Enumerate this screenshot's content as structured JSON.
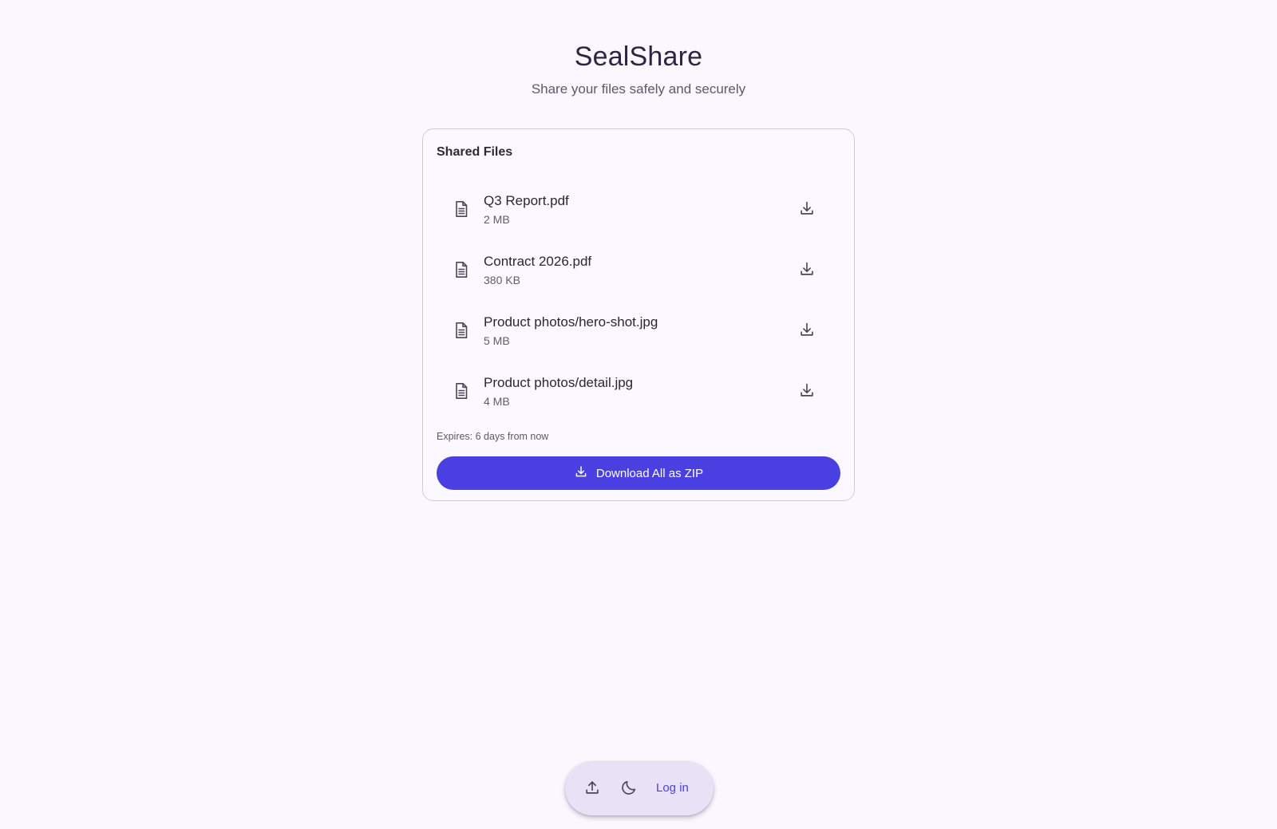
{
  "app": {
    "title": "SealShare",
    "subtitle": "Share your files safely and securely"
  },
  "card": {
    "title": "Shared Files",
    "files": [
      {
        "name": "Q3 Report.pdf",
        "size": "2 MB",
        "icon": "file-document-icon"
      },
      {
        "name": "Contract 2026.pdf",
        "size": "380 KB",
        "icon": "file-document-icon"
      },
      {
        "name": "Product photos/hero-shot.jpg",
        "size": "5 MB",
        "icon": "file-document-icon"
      },
      {
        "name": "Product photos/detail.jpg",
        "size": "4 MB",
        "icon": "file-document-icon"
      }
    ],
    "expires": "Expires: 6 days from now",
    "zip_button_label": "Download All as ZIP"
  },
  "bottom_bar": {
    "upload_icon": "upload-icon",
    "theme_icon": "moon-icon",
    "login_label": "Log in"
  },
  "colors": {
    "accent": "#4a3fe0",
    "background": "#fbf7fe",
    "bar_background": "#e9e2f6"
  }
}
